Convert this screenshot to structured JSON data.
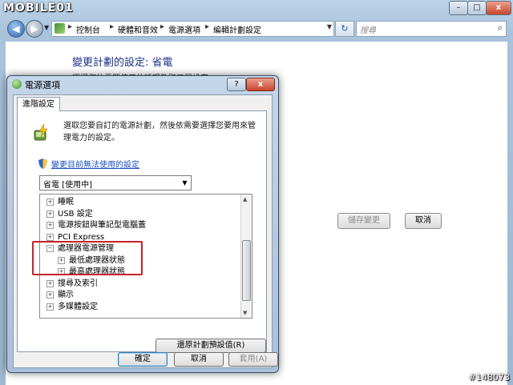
{
  "window": {
    "watermark_logo": "MOBILE01",
    "minimize": "–",
    "maximize": "□",
    "close": "x"
  },
  "nav": {
    "back": "◀",
    "forward": "▶",
    "history": "▼",
    "breadcrumbs": [
      "控制台",
      "硬體和音效",
      "電源選項",
      "編輯計劃設定"
    ],
    "refresh": "↻",
    "search_placeholder": "搜尋"
  },
  "pane": {
    "title": "變更計劃的設定: 省電",
    "subtitle": "選擇您的電腦使用的睡眠及顯示器設定。",
    "save_button": "儲存變更",
    "cancel_button": "取消"
  },
  "dialog": {
    "title": "電源選項",
    "help": "?",
    "close": "x",
    "tab": "進階設定",
    "description": "選取您要自訂的電源計劃，然後依需要選擇您要用來管理電力的設定。",
    "change_link": "變更目前無法使用的設定",
    "plan_selected": "省電 [使用中]",
    "tree": [
      {
        "expander": "+",
        "label": "睡眠",
        "indent": 0
      },
      {
        "expander": "+",
        "label": "USB 設定",
        "indent": 0
      },
      {
        "expander": "+",
        "label": "電源按鈕與筆記型電腦蓋",
        "indent": 0
      },
      {
        "expander": "+",
        "label": "PCI Express",
        "indent": 0
      },
      {
        "expander": "−",
        "label": "處理器電源管理",
        "indent": 0
      },
      {
        "expander": "+",
        "label": "最低處理器狀態",
        "indent": 1
      },
      {
        "expander": "+",
        "label": "最高處理器狀態",
        "indent": 1
      },
      {
        "expander": "+",
        "label": "搜尋及索引",
        "indent": 0
      },
      {
        "expander": "+",
        "label": "顯示",
        "indent": 0
      },
      {
        "expander": "+",
        "label": "多媒體設定",
        "indent": 0
      }
    ],
    "restore_button": "還原計劃預設值(R)",
    "ok_button": "確定",
    "cancel_button": "取消",
    "apply_button": "套用(A)"
  },
  "watermark_id": "#148073",
  "colors": {
    "highlight": "#c6202c",
    "link": "#1b4fbf",
    "title": "#1e3287"
  }
}
